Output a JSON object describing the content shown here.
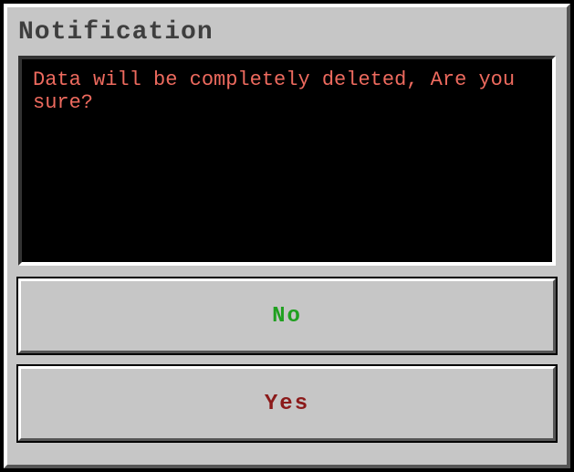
{
  "dialog": {
    "title": "Notification",
    "message": "Data will be completely deleted, Are you sure?",
    "buttons": {
      "no": "No",
      "yes": "Yes"
    }
  }
}
